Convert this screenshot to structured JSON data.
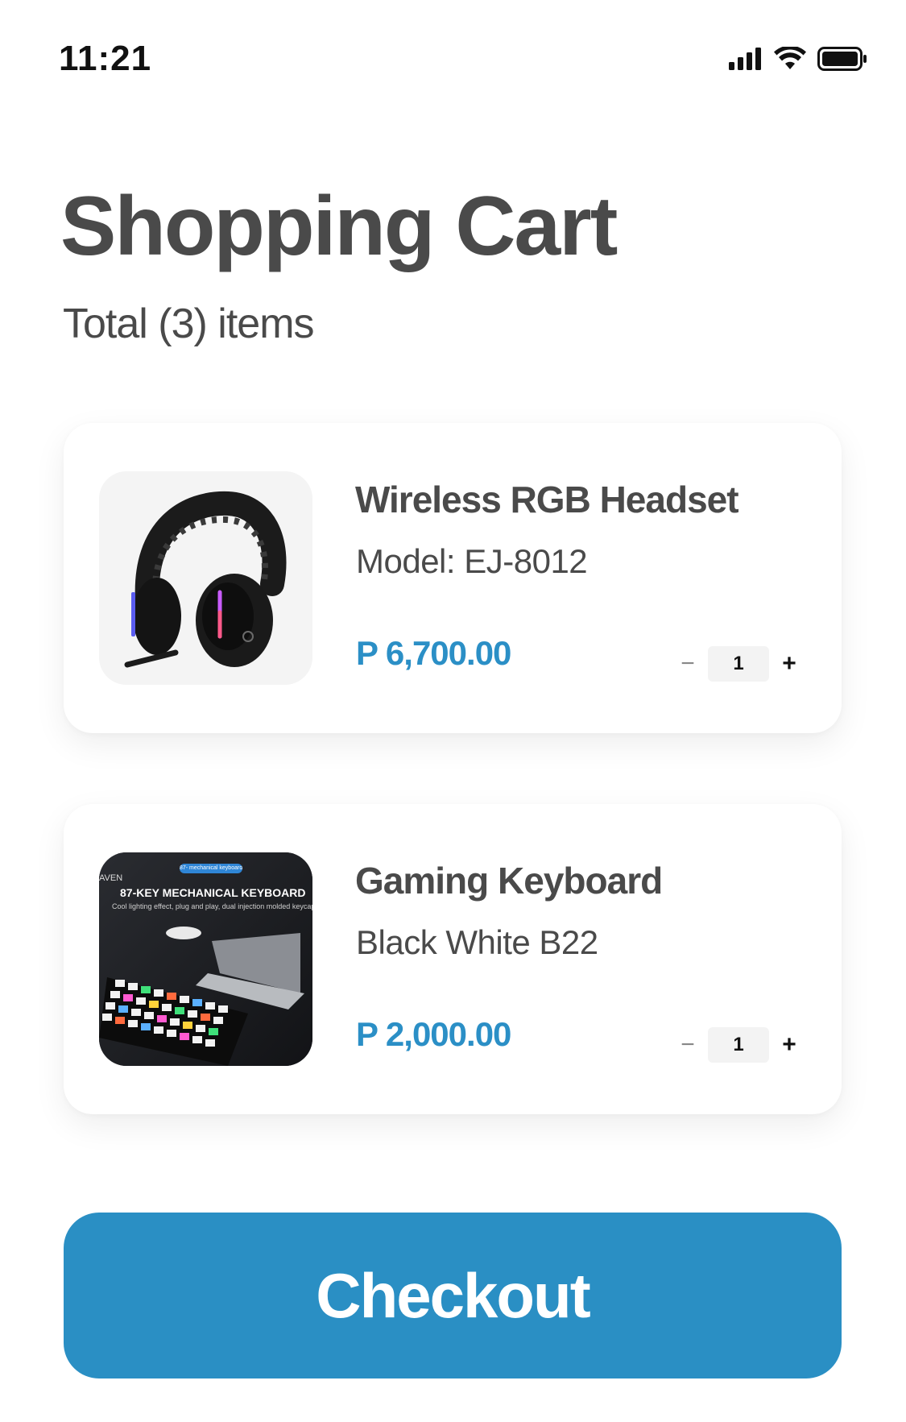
{
  "status_bar": {
    "time": "11:21",
    "icons": [
      "cellular-signal-icon",
      "wifi-icon",
      "battery-icon"
    ]
  },
  "header": {
    "title": "Shopping Cart",
    "subtitle": "Total (3) items"
  },
  "cart": {
    "items": [
      {
        "name": "Wireless RGB Headset",
        "variant": "Model: EJ-8012",
        "price": "P 6,700.00",
        "quantity": "1",
        "minus_label": "−",
        "plus_label": "+",
        "image": "headset-image"
      },
      {
        "name": "Gaming Keyboard",
        "variant": "Black White B22",
        "price": "P 2,000.00",
        "quantity": "1",
        "minus_label": "−",
        "plus_label": "+",
        "image": "keyboard-image",
        "image_text": {
          "pill": "87- mechanical keyboard",
          "brand": "AVEN",
          "headline": "87-KEY MECHANICAL KEYBOARD",
          "subline": "Cool lighting effect, plug and play, dual injection molded keycaps"
        }
      }
    ]
  },
  "checkout": {
    "label": "Checkout"
  },
  "colors": {
    "accent": "#2a8fc4",
    "price": "#2b8fc6",
    "text": "#4a4a4a"
  }
}
